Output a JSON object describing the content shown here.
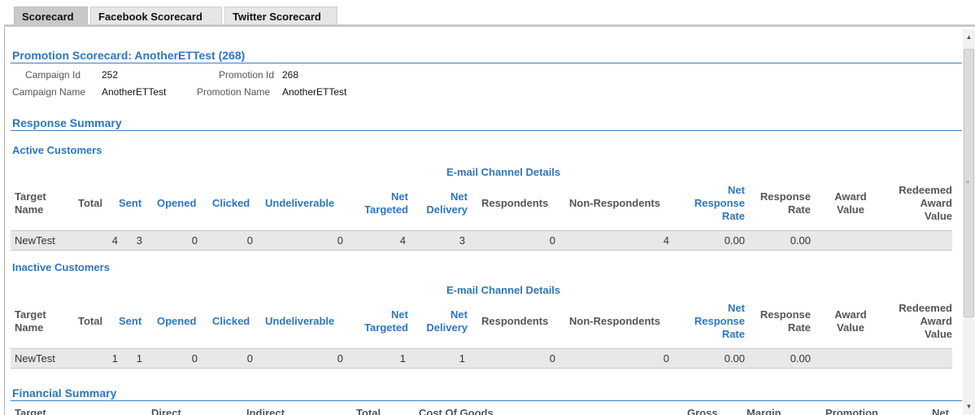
{
  "tabs": [
    "Scorecard",
    "Facebook Scorecard",
    "Twitter Scorecard"
  ],
  "promotion": {
    "title": "Promotion Scorecard: AnotherETTest (268)",
    "campaign_id_label": "Campaign Id",
    "campaign_id": "252",
    "promotion_id_label": "Promotion Id",
    "promotion_id": "268",
    "campaign_name_label": "Campaign Name",
    "campaign_name": "AnotherETTest",
    "promotion_name_label": "Promotion Name",
    "promotion_name": "AnotherETTest"
  },
  "response_summary": {
    "title": "Response Summary",
    "channel_title": "E-mail Channel Details",
    "columns": {
      "target_name": [
        "Target",
        "Name"
      ],
      "total": "Total",
      "sent": "Sent",
      "opened": "Opened",
      "clicked": "Clicked",
      "undeliverable": "Undeliverable",
      "net_targeted": [
        "Net",
        "Targeted"
      ],
      "net_delivery": [
        "Net",
        "Delivery"
      ],
      "respondents": "Respondents",
      "non_respondents": "Non-Respondents",
      "net_response_rate": [
        "Net",
        "Response",
        "Rate"
      ],
      "response_rate": [
        "Response",
        "Rate"
      ],
      "award_value": [
        "Award",
        "Value"
      ],
      "redeemed_award_value": [
        "Redeemed",
        "Award",
        "Value"
      ]
    },
    "groups": [
      {
        "name": "Active Customers",
        "row": {
          "target_name": "NewTest",
          "total": "4",
          "sent": "3",
          "opened": "0",
          "clicked": "0",
          "undeliverable": "0",
          "net_targeted": "4",
          "net_delivery": "3",
          "respondents": "0",
          "non_respondents": "4",
          "net_response_rate": "0.00",
          "response_rate": "0.00",
          "award_value": "",
          "redeemed_award_value": ""
        }
      },
      {
        "name": "Inactive Customers",
        "row": {
          "target_name": "NewTest",
          "total": "1",
          "sent": "1",
          "opened": "0",
          "clicked": "0",
          "undeliverable": "0",
          "net_targeted": "1",
          "net_delivery": "1",
          "respondents": "0",
          "non_respondents": "0",
          "net_response_rate": "0.00",
          "response_rate": "0.00",
          "award_value": "",
          "redeemed_award_value": ""
        }
      }
    ]
  },
  "financial_summary": {
    "title": "Financial Summary",
    "columns": [
      "Target",
      "Direct",
      "Indirect",
      "Total",
      "Cost Of Goods",
      "Gross",
      "Margin",
      "Promotion",
      "Net"
    ]
  },
  "colors": {
    "accent": "#2d76bf",
    "header_gray": "#555555",
    "row_bg": "#e8e8e8"
  }
}
